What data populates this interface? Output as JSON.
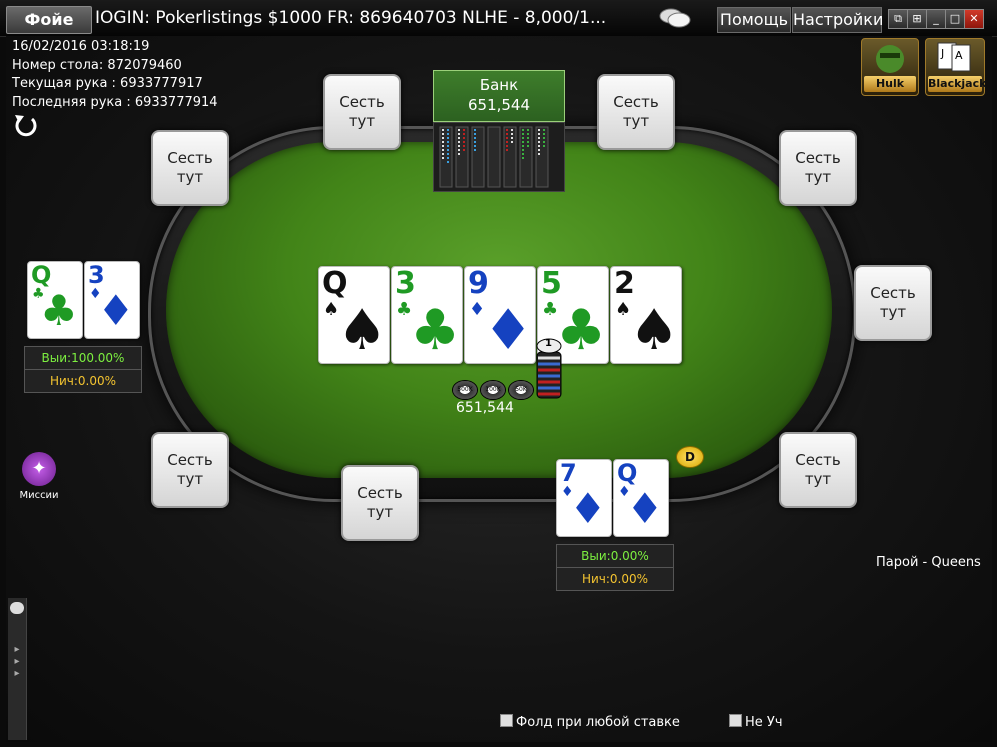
{
  "titlebar": {
    "lobby_label": "Фойе",
    "title": "IOGIN: Pokerlistings $1000 FR: 869640703 NLHE - 8,000/1...",
    "help_label": "Помощь",
    "settings_label": "Настройки"
  },
  "info": {
    "datetime": "16/02/2016 03:18:19",
    "table_number": "Номер стола: 872079460",
    "current_hand": "Текущая рука : 6933777917",
    "last_hand": "Последняя рука : 6933777914"
  },
  "seat_label": [
    "Сесть",
    "тут"
  ],
  "pot": {
    "label": "Банк",
    "amount": "651,544"
  },
  "board": [
    {
      "rank": "Q",
      "suit": "♠",
      "color": "black"
    },
    {
      "rank": "3",
      "suit": "♣",
      "color": "green"
    },
    {
      "rank": "9",
      "suit": "♦",
      "color": "blue"
    },
    {
      "rank": "5",
      "suit": "♣",
      "color": "green"
    },
    {
      "rank": "2",
      "suit": "♠",
      "color": "black"
    }
  ],
  "players": {
    "left": {
      "cards": [
        {
          "rank": "Q",
          "suit": "♣",
          "color": "green"
        },
        {
          "rank": "3",
          "suit": "♦",
          "color": "blue"
        }
      ],
      "win": "Выи:100.00%",
      "tie": "Нич:0.00%"
    },
    "hero": {
      "cards": [
        {
          "rank": "7",
          "suit": "♦",
          "color": "blue"
        },
        {
          "rank": "Q",
          "suit": "♦",
          "color": "blue"
        }
      ],
      "win": "Выи:0.00%",
      "tie": "Нич:0.00%"
    }
  },
  "bet": {
    "amount": "651,544",
    "chips": [
      "500K",
      "100K",
      "50K"
    ],
    "stack_top": "1"
  },
  "dealer_label": "D",
  "hand_description": "Парой   - Queens",
  "missions_label": "Миссии",
  "promos": {
    "hulk": "Hulk",
    "blackjack": "Blackjack"
  },
  "options": {
    "fold_any": "Фолд при любой ставке",
    "sit_out": "Не Уч"
  },
  "colors": {
    "felt": "#428418",
    "pot_box": "#3e7d2b",
    "win_text": "#7df040",
    "tie_text": "#f4c430"
  },
  "icons": [
    "refresh-icon",
    "chat-icon",
    "missions-icon",
    "dealer-button-icon"
  ]
}
